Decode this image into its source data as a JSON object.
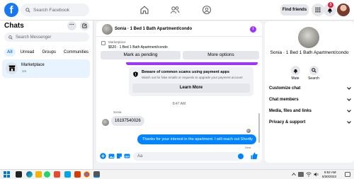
{
  "topbar": {
    "search_placeholder": "Search Facebook",
    "find_friends": "Find friends",
    "notification_count": "3"
  },
  "chats": {
    "title": "Chats",
    "search_placeholder": "Search Messenger",
    "filters": [
      "All",
      "Unread",
      "Groups",
      "Communities"
    ],
    "conversation": {
      "name": "Marketplace",
      "time": "1m"
    }
  },
  "conversation": {
    "title": "Sonia · 1 Bed 1 Bath Apartment/condo",
    "listing_label": "Marketplace",
    "listing_price": "$520 · 1 Bed 1 Bath Apartment/condo",
    "mark_pending": "Mark as pending",
    "more_options": "More options",
    "safety_title": "Beware of common scams using payment apps",
    "safety_sub": "Watch out for fake emails or requests to upgrade your payment account",
    "learn_more": "Learn More",
    "timestamp": "8:47 AM",
    "sender": "Sonia",
    "incoming": "16197540026",
    "outgoing": "Thanks for your interest in the apartment. I will reach out Shortly",
    "sent": "Sent",
    "composer_placeholder": "Aa"
  },
  "info_panel": {
    "title": "Sonia · 1 Bed 1 Bath Apartment/condo",
    "mute": "Mute",
    "search": "Search",
    "sections": [
      "Customize chat",
      "Chat members",
      "Media, files and links",
      "Privacy & support"
    ]
  },
  "taskbar": {
    "time": "8:52 AM",
    "date": "5/30/2023"
  },
  "colors": {
    "facebook_blue": "#1877f2",
    "messenger_blue": "#0084ff",
    "purple": "#a033ff"
  }
}
